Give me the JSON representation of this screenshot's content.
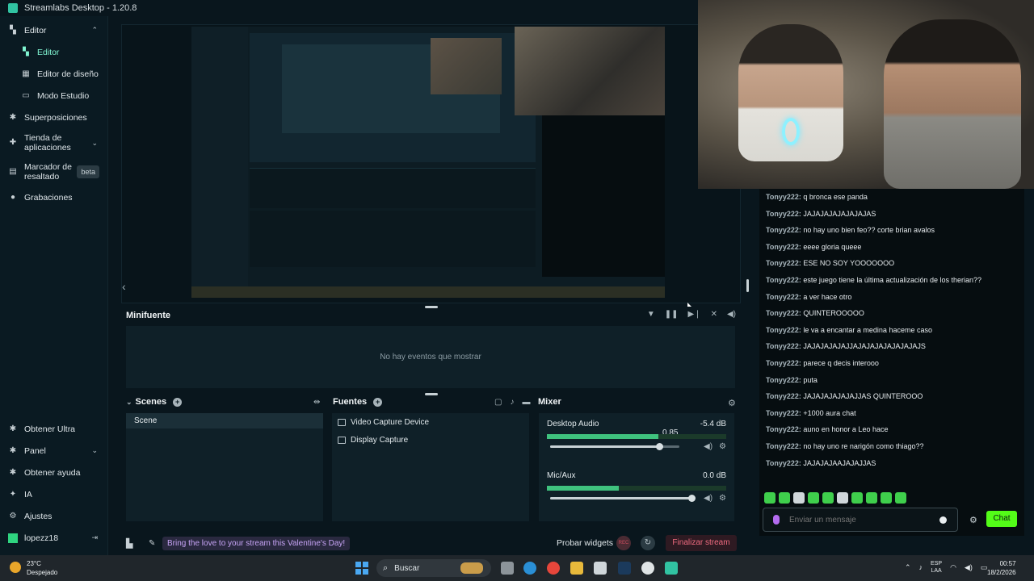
{
  "window": {
    "title": "Streamlabs Desktop - 1.20.8"
  },
  "sidebar": {
    "items": [
      {
        "label": "Editor",
        "icon": "editor-icon"
      },
      {
        "label": "Editor",
        "icon": "editor-sub-icon"
      },
      {
        "label": "Editor de diseño",
        "icon": "layout-icon"
      },
      {
        "label": "Modo Estudio",
        "icon": "studio-icon"
      },
      {
        "label": "Superposiciones",
        "icon": "overlays-icon"
      },
      {
        "label": "Tienda de aplicaciones",
        "icon": "store-icon"
      },
      {
        "label": "Marcador de resaltado",
        "icon": "highlighter-icon",
        "badge": "beta"
      },
      {
        "label": "Grabaciones",
        "icon": "recordings-icon"
      }
    ],
    "bottom": [
      {
        "label": "Obtener Ultra"
      },
      {
        "label": "Panel"
      },
      {
        "label": "Obtener ayuda"
      },
      {
        "label": "IA"
      },
      {
        "label": "Ajustes"
      },
      {
        "label": "lopezz18"
      }
    ]
  },
  "minifuente": {
    "title": "Minifuente",
    "empty_text": "No hay eventos que mostrar"
  },
  "scenes": {
    "title": "Scenes",
    "items": [
      "Scene"
    ]
  },
  "sources": {
    "title": "Fuentes",
    "items": [
      "Video Capture Device",
      "Display Capture"
    ]
  },
  "mixer": {
    "title": "Mixer",
    "channels": [
      {
        "name": "Desktop Audio",
        "volume": "0.85",
        "db": "-5.4 dB",
        "meter_level": 0.62,
        "slider_level": 0.85
      },
      {
        "name": "Mic/Aux",
        "volume": "",
        "db": "0.0 dB",
        "meter_level": 0.4,
        "slider_level": 1.0
      }
    ]
  },
  "footer": {
    "promo": "Bring the love to your stream this Valentine's Day!",
    "test_widgets": "Probar widgets",
    "rec_label": "REC",
    "end_stream": "Finalizar stream"
  },
  "chat": {
    "messages": [
      {
        "user": "Tonyy222:",
        "text": "q bronca ese panda"
      },
      {
        "user": "Tonyy222:",
        "text": "JAJAJAJAJAJAJAJAS"
      },
      {
        "user": "Tonyy222:",
        "text": "no hay uno bien feo?? corte brian avalos"
      },
      {
        "user": "Tonyy222:",
        "text": "eeee gloria queee"
      },
      {
        "user": "Tonyy222:",
        "text": "ESE NO SOY YOOOOOOO"
      },
      {
        "user": "Tonyy222:",
        "text": "este juego tiene la última actualización de los therian??"
      },
      {
        "user": "Tonyy222:",
        "text": "a ver hace otro"
      },
      {
        "user": "Tonyy222:",
        "text": "QUINTEROOOOO"
      },
      {
        "user": "Tonyy222:",
        "text": "le va a encantar a medina haceme caso"
      },
      {
        "user": "Tonyy222:",
        "text": "JAJAJAJAJAJJAJAJAJAJAJAJAJAJS"
      },
      {
        "user": "Tonyy222:",
        "text": "parece q decis interooo"
      },
      {
        "user": "Tonyy222:",
        "text": "puta"
      },
      {
        "user": "Tonyy222:",
        "text": "JAJAJAJAJAJAJJAS QUINTEROOO"
      },
      {
        "user": "Tonyy222:",
        "text": "+1000 aura chat"
      },
      {
        "user": "Tonyy222:",
        "text": "auno en honor a Leo hace"
      },
      {
        "user": "Tonyy222:",
        "text": "no hay uno re narigón como thiago??"
      },
      {
        "user": "Tonyy222:",
        "text": "JAJAJAJAAJAJAJJAS"
      }
    ],
    "input_placeholder": "Enviar un mensaje",
    "send_label": "Chat"
  },
  "taskbar": {
    "weather_temp": "23°C",
    "weather_text": "Despejado",
    "search": "Buscar",
    "lang_top": "ESP",
    "lang_bottom": "LAA",
    "time": "00:57",
    "date": "18/2/2026"
  },
  "colors": {
    "accent": "#80f5d2",
    "chat_button": "#53fc18",
    "end_stream": "#f06b80",
    "promo": "#c7a4f5"
  }
}
